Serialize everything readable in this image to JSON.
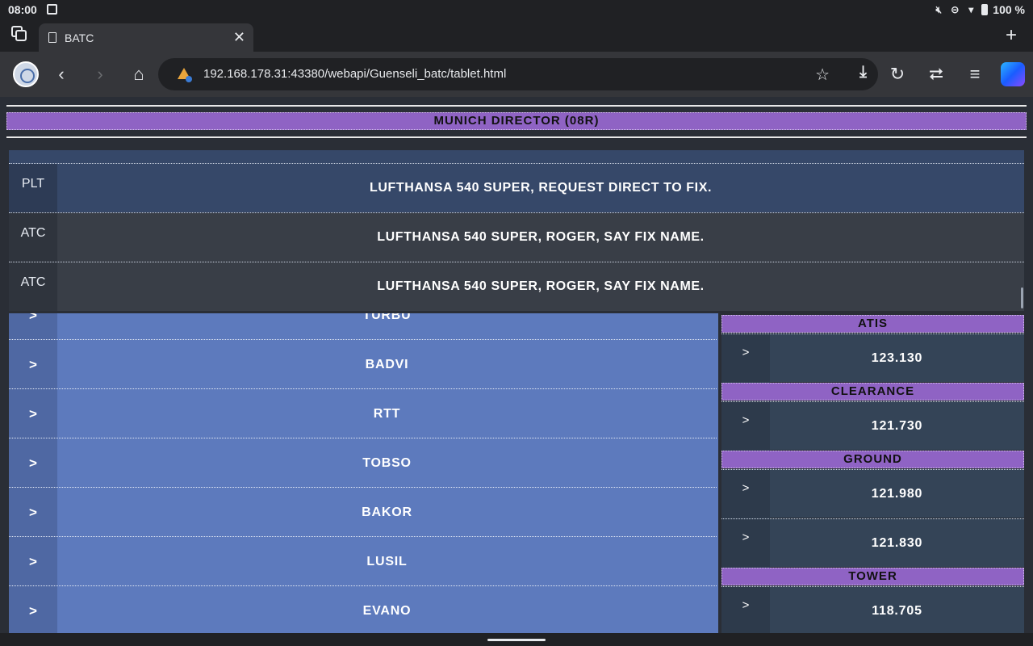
{
  "status": {
    "time": "08:00",
    "battery": "100 %"
  },
  "tab": {
    "title": "BATC"
  },
  "toolbar": {
    "url": "192.168.178.31:43380/webapi/Guenseli_batc/tablet.html"
  },
  "page": {
    "director_label": "MUNICH DIRECTOR (08R)",
    "log": [
      {
        "who": "PLT",
        "msg": "LUFTHANSA 540 SUPER, REQUEST DIRECT TO FIX."
      },
      {
        "who": "ATC",
        "msg": "LUFTHANSA 540 SUPER, ROGER, SAY FIX NAME."
      },
      {
        "who": "ATC",
        "msg": "LUFTHANSA 540 SUPER, ROGER, SAY FIX NAME."
      }
    ],
    "fixes": [
      {
        "arrow": ">",
        "name": "TURBU"
      },
      {
        "arrow": ">",
        "name": "BADVI"
      },
      {
        "arrow": ">",
        "name": "RTT"
      },
      {
        "arrow": ">",
        "name": "TOBSO"
      },
      {
        "arrow": ">",
        "name": "BAKOR"
      },
      {
        "arrow": ">",
        "name": "LUSIL"
      },
      {
        "arrow": ">",
        "name": "EVANO"
      }
    ],
    "freq_sections": {
      "atis": {
        "label": "ATIS",
        "rows": [
          {
            "arrow": ">",
            "value": "123.130"
          }
        ]
      },
      "clearance": {
        "label": "CLEARANCE",
        "rows": [
          {
            "arrow": ">",
            "value": "121.730"
          }
        ]
      },
      "ground": {
        "label": "GROUND",
        "rows": [
          {
            "arrow": ">",
            "value": "121.980"
          },
          {
            "arrow": ">",
            "value": "121.830"
          }
        ]
      },
      "tower": {
        "label": "TOWER",
        "rows": [
          {
            "arrow": ">",
            "value": "118.705"
          }
        ]
      }
    }
  }
}
